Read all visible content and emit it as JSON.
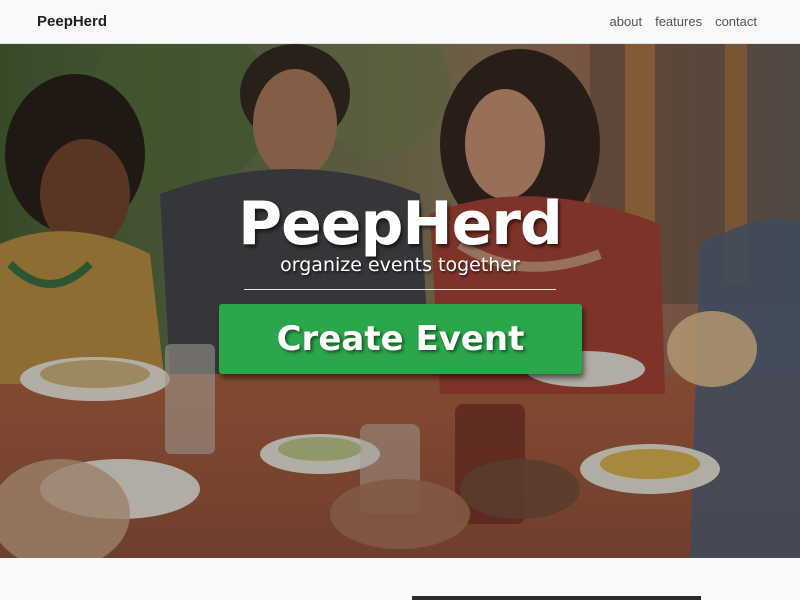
{
  "navbar": {
    "brand": "PeepHerd",
    "links": [
      {
        "label": "about"
      },
      {
        "label": "features"
      },
      {
        "label": "contact"
      }
    ]
  },
  "hero": {
    "title": "PeepHerd",
    "subtitle": "organize events together",
    "cta_label": "Create Event",
    "cta_color": "#2aa74a",
    "background_image": "friends-dining-photo"
  }
}
